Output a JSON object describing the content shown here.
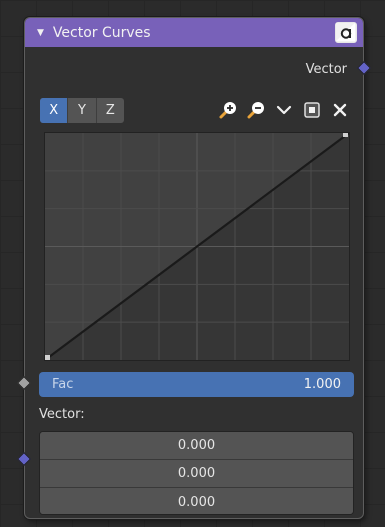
{
  "node": {
    "title": "Vector Curves",
    "output_label": "Vector",
    "channels": [
      {
        "label": "X",
        "active": true
      },
      {
        "label": "Y",
        "active": false
      },
      {
        "label": "Z",
        "active": false
      }
    ],
    "tools": [
      "zoom-in-icon",
      "zoom-out-icon",
      "chevron-down-icon",
      "clipping-toggle-icon",
      "reset-x-icon"
    ],
    "curve": {
      "points": [
        [
          -1,
          -1
        ],
        [
          1,
          1
        ]
      ]
    },
    "fac": {
      "label": "Fac",
      "value": "1.000"
    },
    "vector_input": {
      "label": "Vector:",
      "values": [
        "0.000",
        "0.000",
        "0.000"
      ]
    }
  },
  "colors": {
    "header": "#7861b9",
    "socket_vector": "#6363c7",
    "socket_float": "#a1a1a1",
    "accent": "#4772b3",
    "node_bg": "#303030",
    "editor_bg": "#2b2b2b"
  }
}
